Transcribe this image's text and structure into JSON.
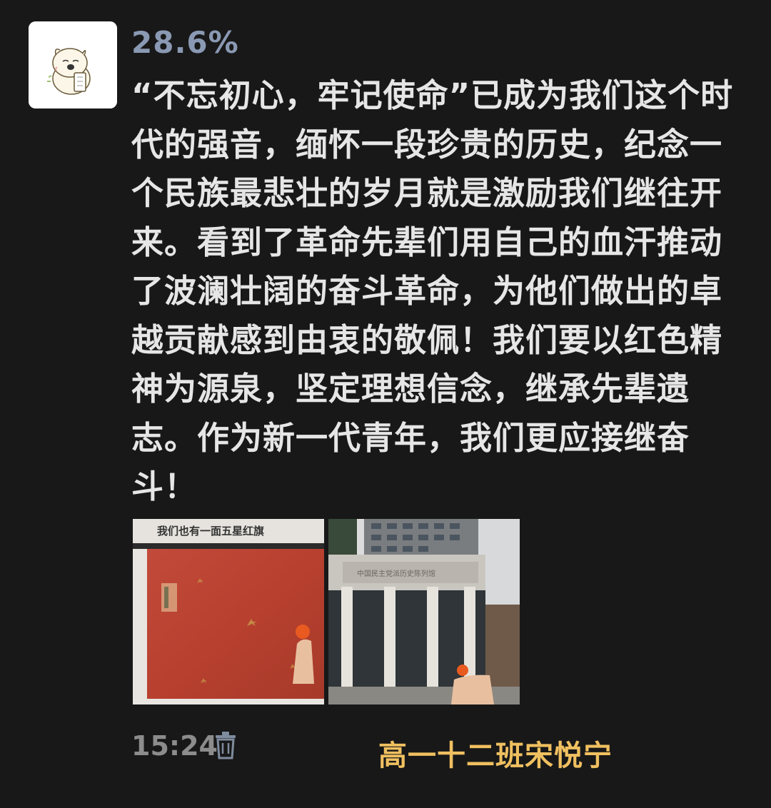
{
  "post": {
    "nickname": "28.6%",
    "text_lines": [
      "“不忘初心，牢记使命”已成为我们这个时",
      "代的强音，缅怀一段珍贵的历史，纪念一",
      "个民族最悲壮的岁月就是激励我们继往开",
      "来。看到了革命先辈们用自己的血汗推动",
      "了波澜壮阔的奋斗革命，为他们做出的卓",
      "越贡献感到由衷的敬佩！我们要以红色精",
      "神为源泉，坚定理想信念，继承先辈遗",
      "志。作为新一代青年，我们更应接继奋",
      "斗！"
    ],
    "photos": {
      "photo_1_sign": "我们也有一面五星红旗",
      "photo_1_caption_small": "",
      "photo_2_sign": "中国民主党派历史陈列馆"
    },
    "time": "15:24",
    "delete_icon": "trash-icon"
  },
  "overlay": {
    "caption": "高一十二班宋悦宁"
  },
  "colors": {
    "background": "#181818",
    "nickname": "#8a99b3",
    "text": "#e6e6e6",
    "time": "#8c8c8c",
    "caption": "#f0c060"
  }
}
